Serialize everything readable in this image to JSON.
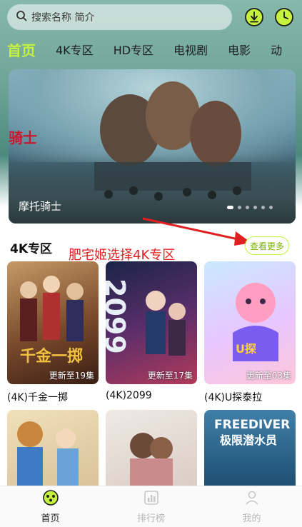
{
  "search": {
    "placeholder": "搜索名称 简介"
  },
  "icons": {
    "download": "download-icon",
    "history": "history-icon",
    "search": "search-icon"
  },
  "tabs": [
    "首页",
    "4K专区",
    "HD专区",
    "电视剧",
    "电影",
    "动"
  ],
  "banner": {
    "side_title": "骑士",
    "caption": "摩托骑士",
    "dot_count": 6,
    "active_dot": 0
  },
  "section": {
    "title": "4K专区",
    "more_label": "查看更多"
  },
  "annotation": "肥宅姬选择4K专区",
  "cards": [
    {
      "title": "(4K)千金一掷",
      "badge": "更新至19集"
    },
    {
      "title": "(4K)2099",
      "badge": "更新至17集"
    },
    {
      "title": "(4K)U探泰拉",
      "badge": "更新至03集"
    }
  ],
  "bottom_nav": [
    {
      "label": "首页",
      "icon": "home-icon"
    },
    {
      "label": "排行榜",
      "icon": "ranking-icon"
    },
    {
      "label": "我的",
      "icon": "profile-icon"
    }
  ],
  "colors": {
    "accent": "#c4f23d",
    "annotation": "#e02020"
  }
}
